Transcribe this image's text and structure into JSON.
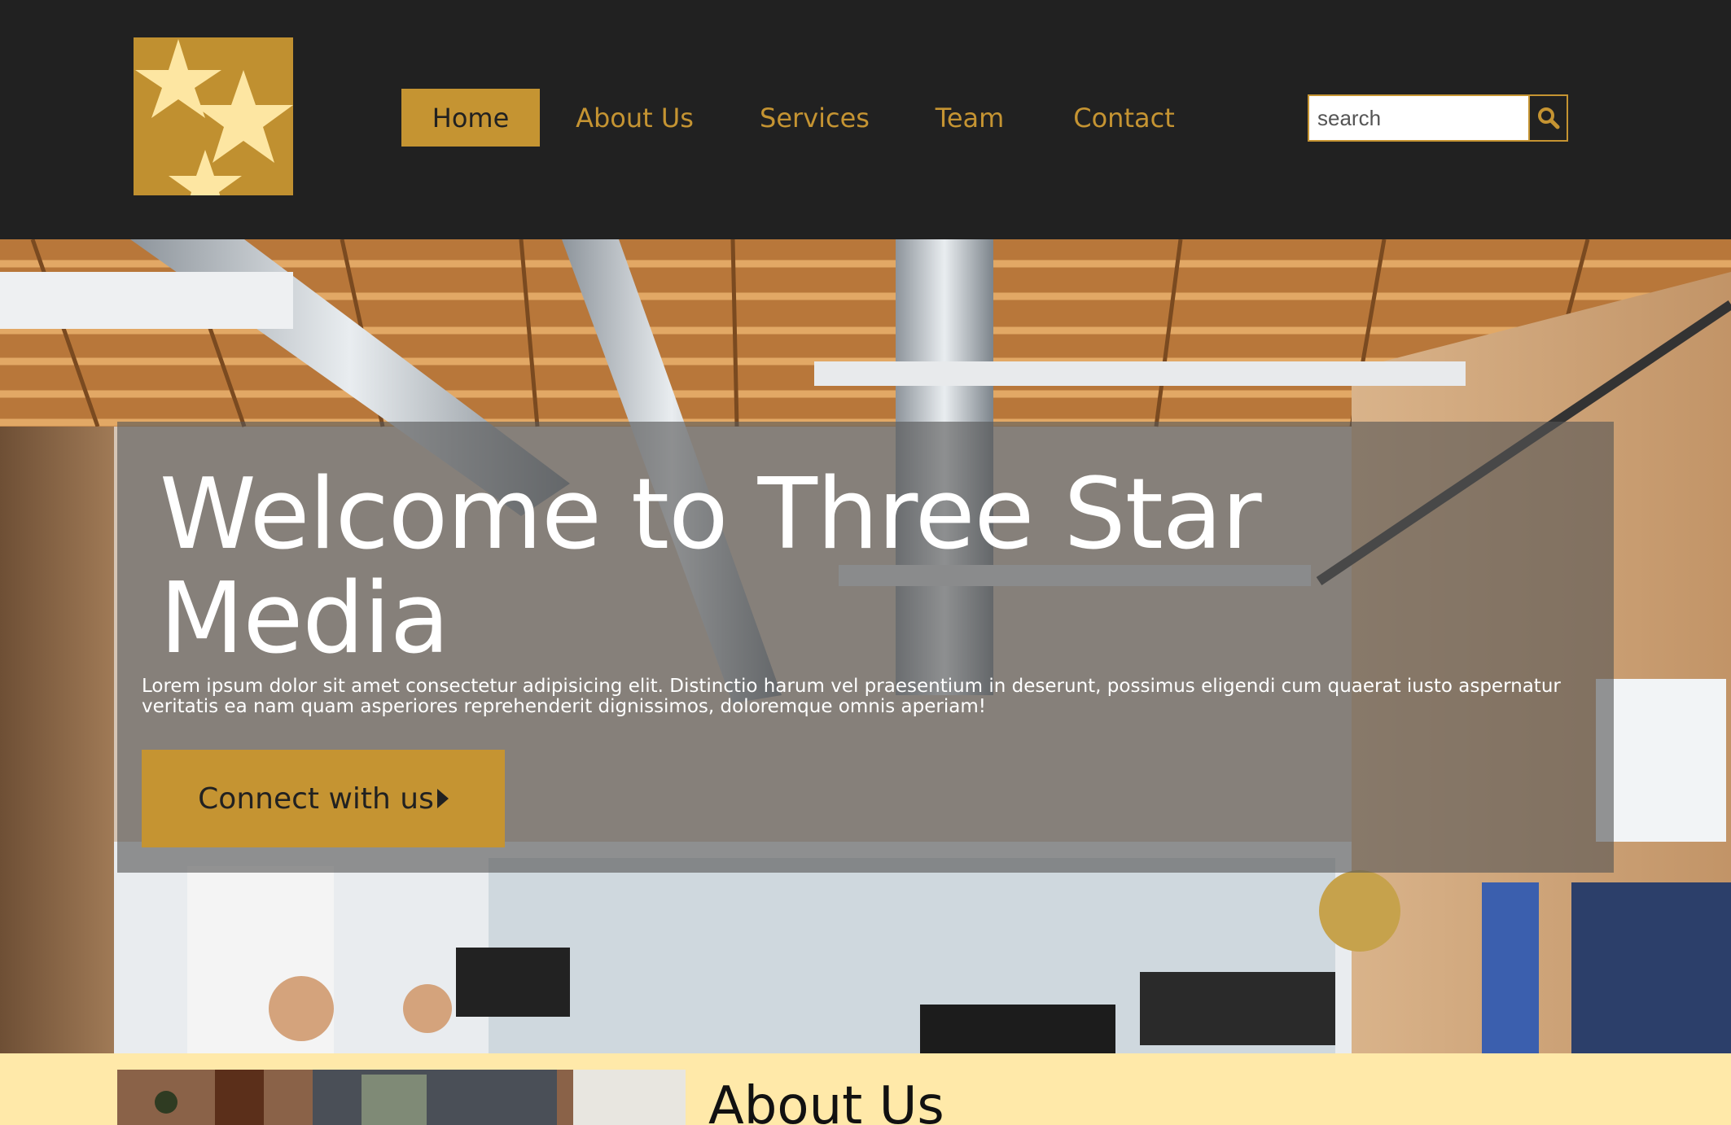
{
  "brand": {
    "logo_icon": "three-stars-icon",
    "color": "#c59432",
    "star_color": "#fde6a2"
  },
  "nav": {
    "items": [
      {
        "label": "Home",
        "active": true
      },
      {
        "label": "About Us",
        "active": false
      },
      {
        "label": "Services",
        "active": false
      },
      {
        "label": "Team",
        "active": false
      },
      {
        "label": "Contact",
        "active": false
      }
    ]
  },
  "search": {
    "placeholder": "search",
    "icon": "search-icon"
  },
  "hero": {
    "title": "Welcome to Three Star Media",
    "text": "Lorem ipsum dolor sit amet consectetur adipisicing elit. Distinctio harum vel praesentium in deserunt, possimus eligendi cum quaerat iusto aspernatur veritatis ea nam quam asperiores reprehenderit dignissimos, doloremque omnis aperiam!",
    "cta_label": "Connect with us"
  },
  "about": {
    "title": "About Us"
  },
  "colors": {
    "header_bg": "#212121",
    "accent": "#c59432",
    "section_bg": "#ffe9a9"
  }
}
